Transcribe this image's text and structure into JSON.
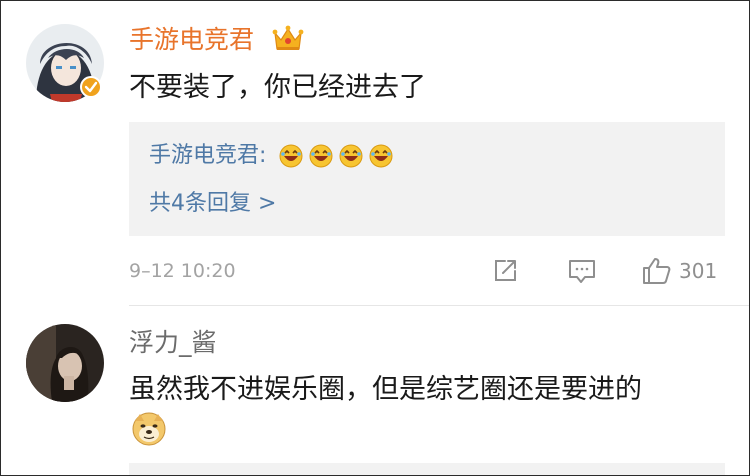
{
  "comments": [
    {
      "username": "手游电竞君",
      "username_color": "#e8742b",
      "verified": true,
      "badge": "crown-icon",
      "text": "不要装了，你已经进去了",
      "reply_preview": {
        "author": "手游电竞君:",
        "emojis": [
          "laughing-emoji",
          "laughing-emoji",
          "laughing-emoji",
          "laughing-emoji"
        ],
        "more_label": "共4条回复 >"
      },
      "timestamp": "9–12 10:20",
      "like_count": "301"
    },
    {
      "username": "浮力_酱",
      "username_color": "#6b6b6b",
      "text": "虽然我不进娱乐圈，但是综艺圈还是要进的",
      "emoji": "doge-emoji"
    }
  ],
  "colors": {
    "link": "#4f79a6",
    "meta": "#a3a3a3",
    "accent_orange": "#e8742b",
    "verified_badge": "#f0a21d"
  }
}
